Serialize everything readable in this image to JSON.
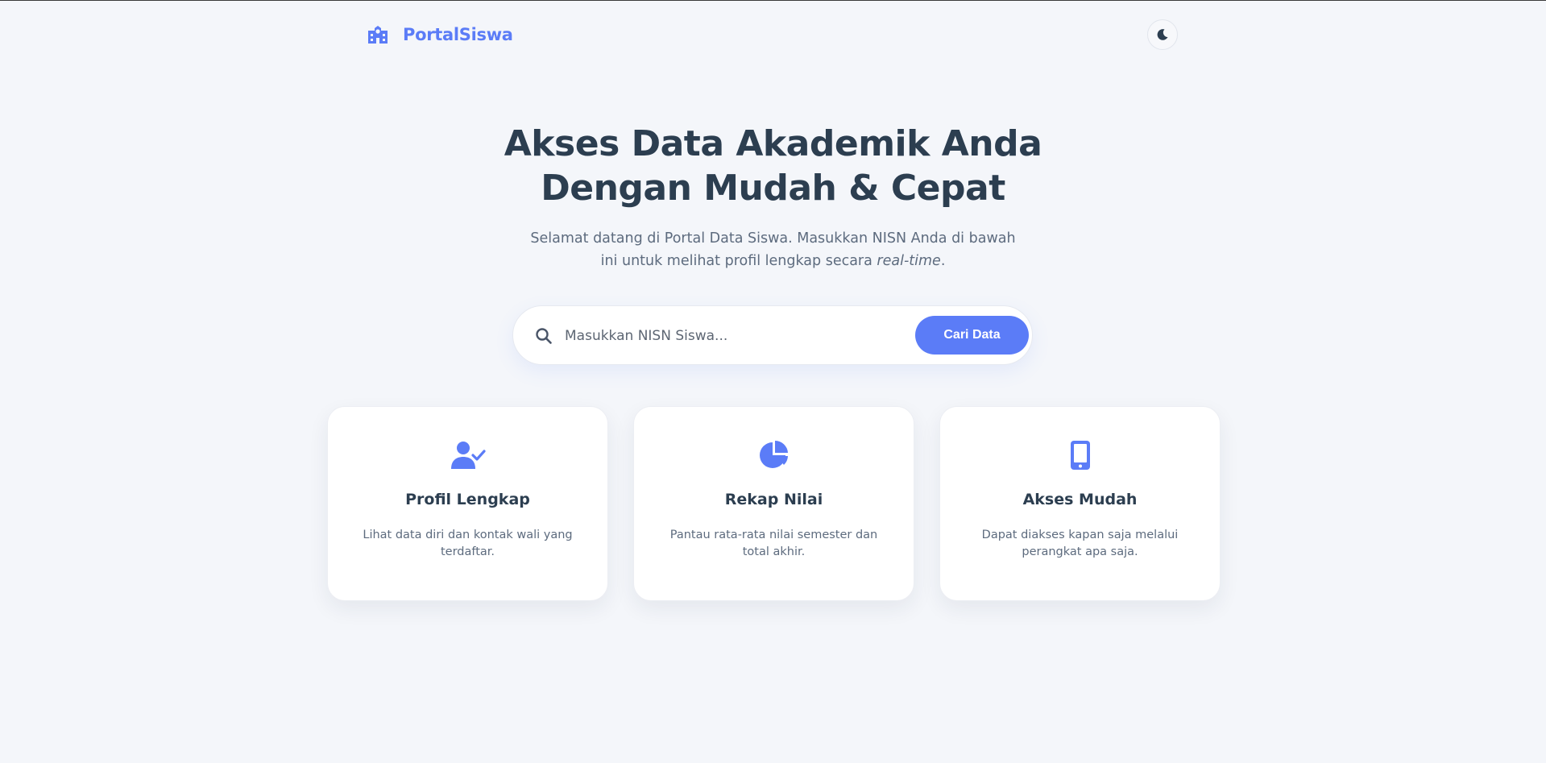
{
  "navbar": {
    "brand_name": "PortalSiswa",
    "brand_icon": "school-icon",
    "theme_toggle_icon": "moon-icon"
  },
  "hero": {
    "title_line1": "Akses Data Akademik Anda",
    "title_line2": "Dengan Mudah & Cepat",
    "subtitle_prefix": "Selamat datang di Portal Data Siswa. Masukkan NISN Anda di bawah ini untuk melihat profil lengkap secara ",
    "subtitle_emphasis": "real-time",
    "subtitle_suffix": "."
  },
  "search": {
    "placeholder": "Masukkan NISN Siswa...",
    "value": "",
    "button_label": "Cari Data",
    "icon": "search-icon"
  },
  "features": [
    {
      "icon": "user-check-icon",
      "title": "Profil Lengkap",
      "description": "Lihat data diri dan kontak wali yang terdaftar."
    },
    {
      "icon": "pie-chart-icon",
      "title": "Rekap Nilai",
      "description": "Pantau rata-rata nilai semester dan total akhir."
    },
    {
      "icon": "mobile-phone-icon",
      "title": "Akses Mudah",
      "description": "Dapat diakses kapan saja melalui perangkat apa saja."
    }
  ],
  "colors": {
    "accent": "#5b7cf7",
    "heading": "#2c3e50",
    "body_text": "#5d6b7e",
    "background": "#f4f6fa"
  }
}
